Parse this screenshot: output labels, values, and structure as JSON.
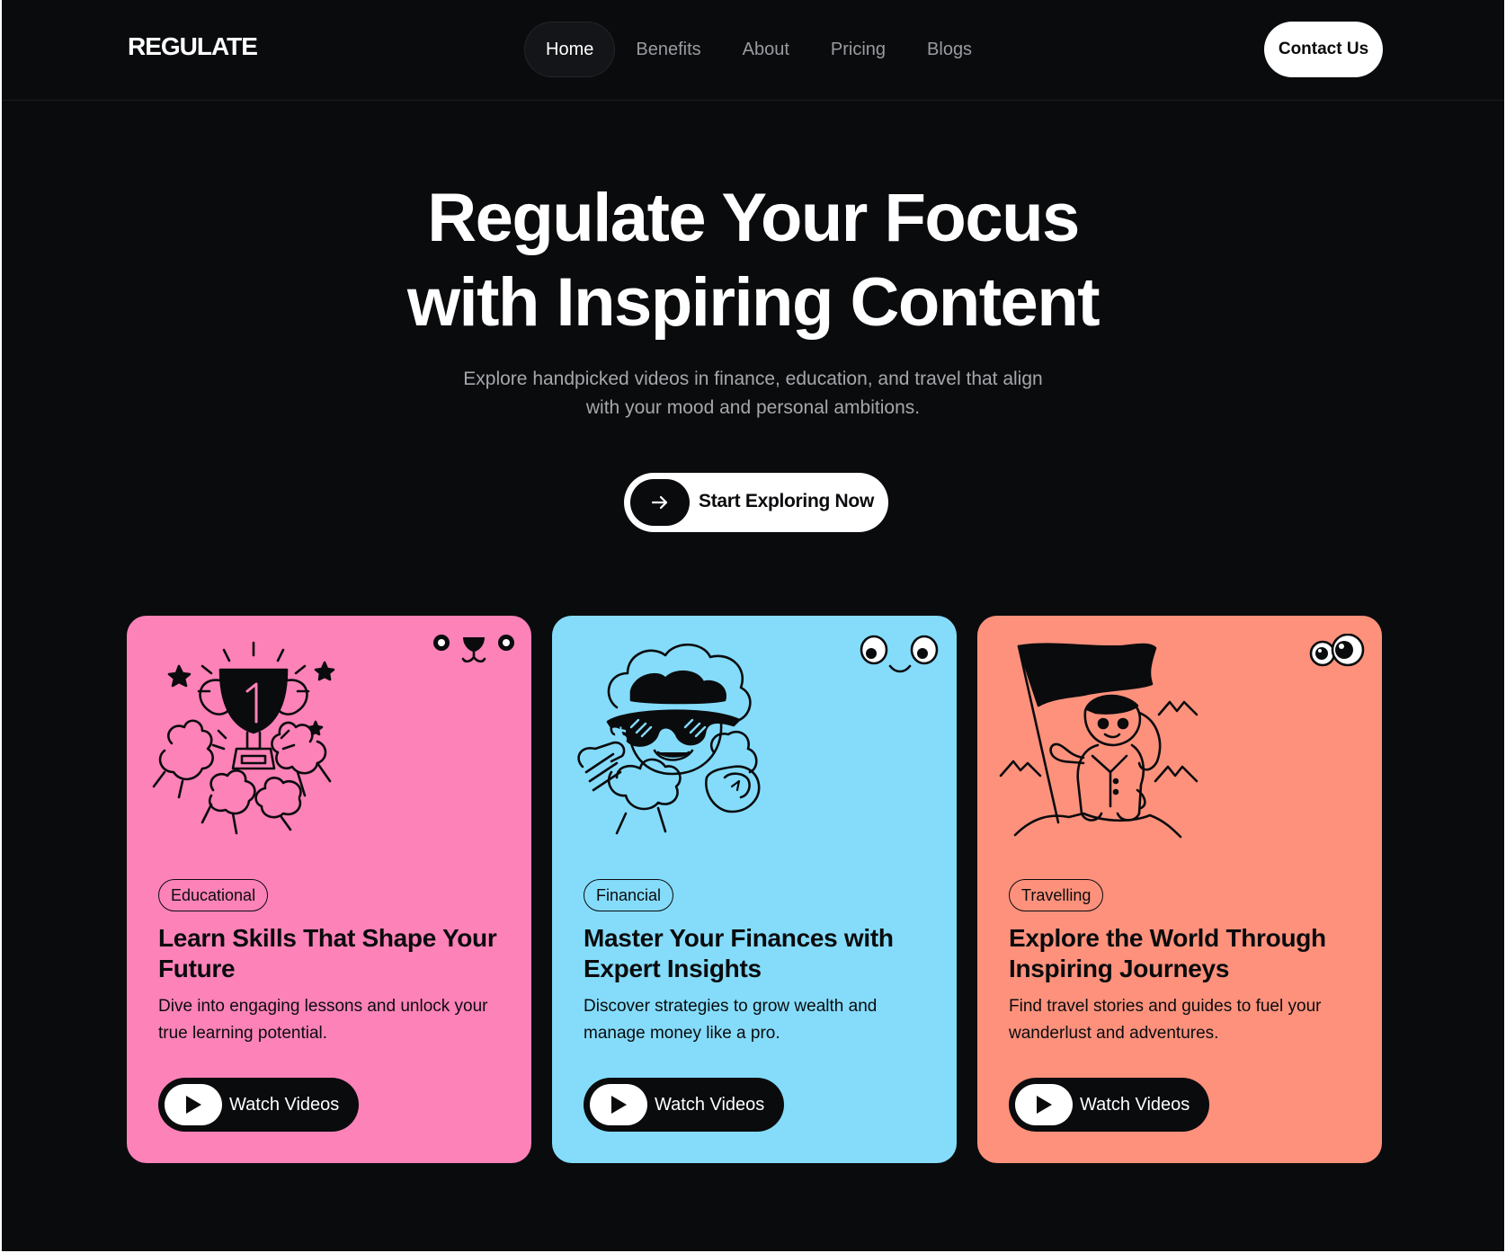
{
  "brand": {
    "logo": "REGULATE"
  },
  "nav": {
    "items": [
      {
        "label": "Home",
        "active": true
      },
      {
        "label": "Benefits"
      },
      {
        "label": "About"
      },
      {
        "label": "Pricing"
      },
      {
        "label": "Blogs"
      }
    ],
    "contact_label": "Contact Us"
  },
  "hero": {
    "title_line1": "Regulate Your Focus",
    "title_line2": "with Inspiring Content",
    "subtitle_line1": "Explore handpicked videos in finance, education, and travel that align",
    "subtitle_line2": "with your mood and personal ambitions.",
    "cta_label": "Start Exploring Now",
    "cta_icon": "arrow-right-icon"
  },
  "cards": [
    {
      "tag": "Educational",
      "title": "Learn Skills That Shape Your Future",
      "description": "Dive into engaging lessons and unlock your true learning potential.",
      "button_label": "Watch Videos",
      "illustration": "trophy-illustration",
      "face": "bear-face-icon",
      "color": "#fd82b8"
    },
    {
      "tag": "Financial",
      "title": "Master Your Finances with Expert Insights",
      "description": "Discover strategies to grow wealth and manage money like a pro.",
      "button_label": "Watch Videos",
      "illustration": "rich-guy-illustration",
      "face": "smile-face-icon",
      "color": "#84dcfa"
    },
    {
      "tag": "Travelling",
      "title": "Explore the World Through Inspiring Journeys",
      "description": "Find travel stories and guides to fuel your wanderlust and adventures.",
      "button_label": "Watch Videos",
      "illustration": "flag-explorer-illustration",
      "face": "googly-eyes-icon",
      "color": "#fd917c"
    }
  ],
  "colors": {
    "background": "#0a0b0d",
    "card_educational": "#fd82b8",
    "card_financial": "#84dcfa",
    "card_travelling": "#fd917c"
  }
}
